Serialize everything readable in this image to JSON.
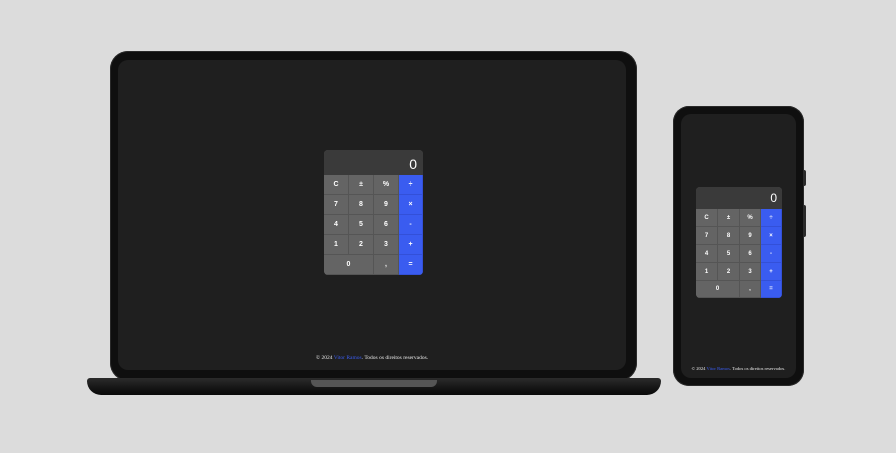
{
  "calculator": {
    "display": "0",
    "keys": {
      "clear": "C",
      "sign": "±",
      "percent": "%",
      "divide": "÷",
      "seven": "7",
      "eight": "8",
      "nine": "9",
      "multiply": "×",
      "four": "4",
      "five": "5",
      "six": "6",
      "minus": "-",
      "one": "1",
      "two": "2",
      "three": "3",
      "plus": "+",
      "zero": "0",
      "decimal": ",",
      "equals": "="
    }
  },
  "footer": {
    "prefix": "© 2024",
    "author": "Vitor Ramos",
    "suffix": ". Todos os direitos reservados."
  },
  "colors": {
    "operator": "#3a5cf0",
    "key": "#646464",
    "display": "#3a3a3a",
    "screen": "#1f1f1f",
    "backdrop": "#dcdcdc"
  }
}
